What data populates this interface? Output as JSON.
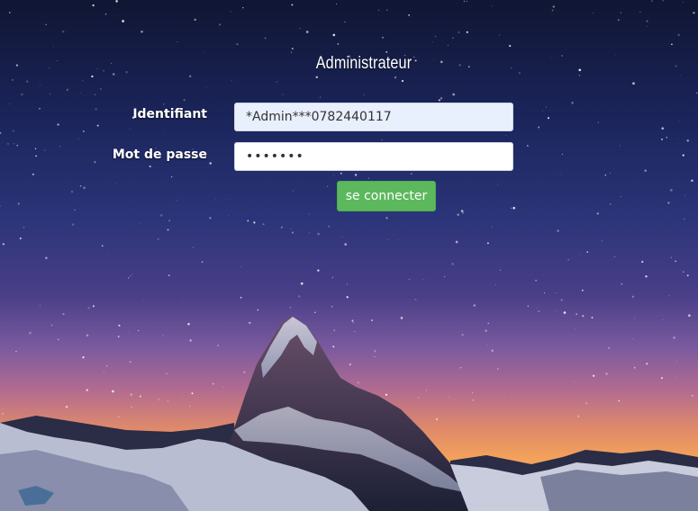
{
  "form": {
    "title": "Administrateur",
    "login_label": "Identifiant",
    "login_value": "*Admin***0782440117",
    "password_label": "Mot de passe",
    "password_value": "•••••••",
    "submit_label": "se connecter"
  },
  "colors": {
    "button": "#5cb85c",
    "login_field_bg": "#e8f0fe"
  }
}
